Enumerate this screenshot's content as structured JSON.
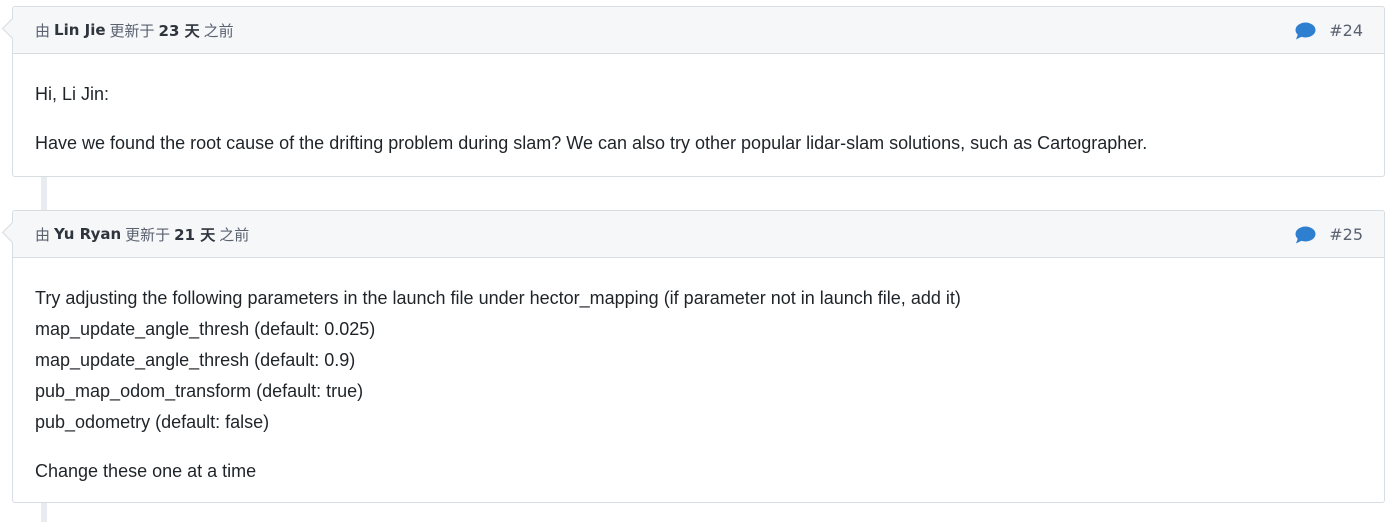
{
  "journals": [
    {
      "prefix": "由",
      "author": "Lin Jie",
      "updated_text": "更新于",
      "days": "23 天",
      "ago_text": "之前",
      "note_number": "#24",
      "icon": "comment-icon",
      "paragraphs": [
        "Hi, Li Jin:",
        "Have we found the root cause of the drifting problem during slam? We can also try other popular lidar-slam solutions, such as Cartographer."
      ]
    },
    {
      "prefix": "由",
      "author": "Yu Ryan",
      "updated_text": "更新于",
      "days": "21 天",
      "ago_text": "之前",
      "note_number": "#25",
      "icon": "comment-icon",
      "lines": [
        "Try adjusting the following parameters in the launch file under hector_mapping (if parameter not in launch file, add it)",
        "map_update_angle_thresh (default: 0.025)",
        "map_update_angle_thresh (default: 0.9)",
        "pub_map_odom_transform (default: true)",
        "pub_odometry (default: false)"
      ],
      "closing": "Change these one at a time"
    }
  ],
  "colors": {
    "icon_blue": "#2f7fd1",
    "header_bg": "#f6f7f9",
    "border": "#d8dde2"
  }
}
